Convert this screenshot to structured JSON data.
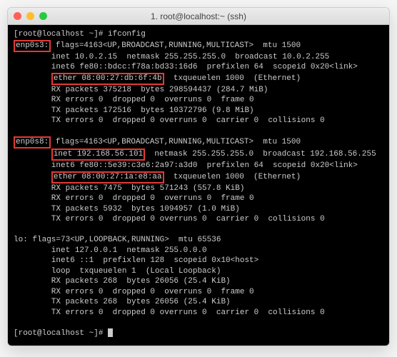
{
  "window": {
    "title": "1. root@localhost:~ (ssh)"
  },
  "prompt": "[root@localhost ~]# ",
  "command": "ifconfig",
  "if0": {
    "name": "enp0s3:",
    "flags": " flags=4163<UP,BROADCAST,RUNNING,MULTICAST>  mtu 1500",
    "inet": "        inet 10.0.2.15  netmask 255.255.255.0  broadcast 10.0.2.255",
    "inet6": "        inet6 fe80::bdcc:f78a:bd33:16d6  prefixlen 64  scopeid 0x20<link>",
    "ether": "ether 08:00:27:db:6f:4b",
    "etherTail": "  txqueuelen 1000  (Ethernet)",
    "rxp": "        RX packets 375218  bytes 298594437 (284.7 MiB)",
    "rxe": "        RX errors 0  dropped 0  overruns 0  frame 0",
    "txp": "        TX packets 172516  bytes 10372796 (9.8 MiB)",
    "txe": "        TX errors 0  dropped 0 overruns 0  carrier 0  collisions 0"
  },
  "if1": {
    "name": "enp0s8:",
    "flags": " flags=4163<UP,BROADCAST,RUNNING,MULTICAST>  mtu 1500",
    "inetLabel": "inet 192.168.56.101",
    "inetTail": "  netmask 255.255.255.0  broadcast 192.168.56.255",
    "inet6": "        inet6 fe80::5e39:c3e6:2a97:a3d0  prefixlen 64  scopeid 0x20<link>",
    "ether": "ether 08:00:27:1a:e8:aa",
    "etherTail": "  txqueuelen 1000  (Ethernet)",
    "rxp": "        RX packets 7475  bytes 571243 (557.8 KiB)",
    "rxe": "        RX errors 0  dropped 0  overruns 0  frame 0",
    "txp": "        TX packets 5932  bytes 1094957 (1.0 MiB)",
    "txe": "        TX errors 0  dropped 0 overruns 0  carrier 0  collisions 0"
  },
  "lo": {
    "header": "lo: flags=73<UP,LOOPBACK,RUNNING>  mtu 65536",
    "inet": "        inet 127.0.0.1  netmask 255.0.0.0",
    "inet6": "        inet6 ::1  prefixlen 128  scopeid 0x10<host>",
    "loop": "        loop  txqueuelen 1  (Local Loopback)",
    "rxp": "        RX packets 268  bytes 26056 (25.4 KiB)",
    "rxe": "        RX errors 0  dropped 0  overruns 0  frame 0",
    "txp": "        TX packets 268  bytes 26056 (25.4 KiB)",
    "txe": "        TX errors 0  dropped 0 overruns 0  carrier 0  collisions 0"
  },
  "highlights": {
    "if0_name": "enp0s3:",
    "if0_ether": "ether 08:00:27:db:6f:4b",
    "if1_name": "enp0s8:",
    "if1_inet": "inet 192.168.56.101",
    "if1_ether": "ether 08:00:27:1a:e8:aa"
  }
}
